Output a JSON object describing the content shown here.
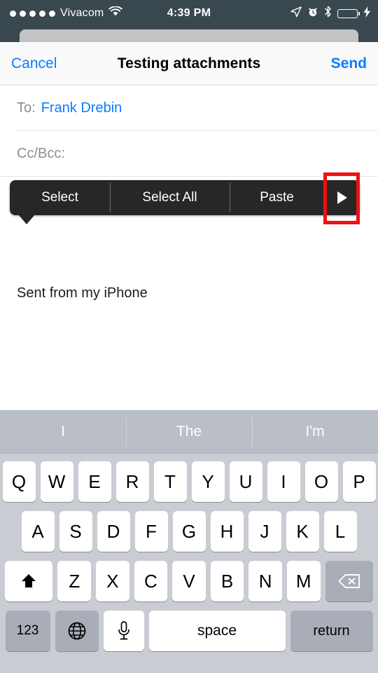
{
  "status_bar": {
    "signal_dots": 5,
    "carrier": "Vivacom",
    "wifi_icon": "wifi-icon",
    "time": "4:39 PM",
    "location_icon": "location-arrow-icon",
    "alarm_icon": "alarm-clock-icon",
    "bluetooth_icon": "bluetooth-icon",
    "battery_icon": "battery-icon",
    "battery_level": 100,
    "charging_icon": "lightning-bolt-icon",
    "background_color": "#39474e"
  },
  "nav_bar": {
    "cancel_label": "Cancel",
    "title": "Testing attachments",
    "send_label": "Send",
    "accent_color": "#0a7cff"
  },
  "compose": {
    "to": {
      "label": "To:",
      "value": "Frank Drebin"
    },
    "ccbcc": {
      "label": "Cc/Bcc:",
      "value": ""
    },
    "body_signature": "Sent from my iPhone"
  },
  "context_menu": {
    "items": [
      {
        "label": "Select",
        "name": "select"
      },
      {
        "label": "Select All",
        "name": "select-all"
      },
      {
        "label": "Paste",
        "name": "paste"
      },
      {
        "label": "▶",
        "name": "more-arrow"
      }
    ],
    "background_color": "#272727",
    "highlight_color": "#ee1111",
    "highlighted_item": "more-arrow"
  },
  "keyboard": {
    "predictions": [
      "I",
      "The",
      "I'm"
    ],
    "row1": [
      "Q",
      "W",
      "E",
      "R",
      "T",
      "Y",
      "U",
      "I",
      "O",
      "P"
    ],
    "row2": [
      "A",
      "S",
      "D",
      "F",
      "G",
      "H",
      "J",
      "K",
      "L"
    ],
    "row3_letters": [
      "Z",
      "X",
      "C",
      "V",
      "B",
      "N",
      "M"
    ],
    "shift_icon": "shift-arrow-icon",
    "delete_icon": "backspace-icon",
    "numbers_label": "123",
    "globe_icon": "globe-icon",
    "mic_icon": "microphone-icon",
    "space_label": "space",
    "return_label": "return",
    "background_color": "#c9ccd3"
  }
}
